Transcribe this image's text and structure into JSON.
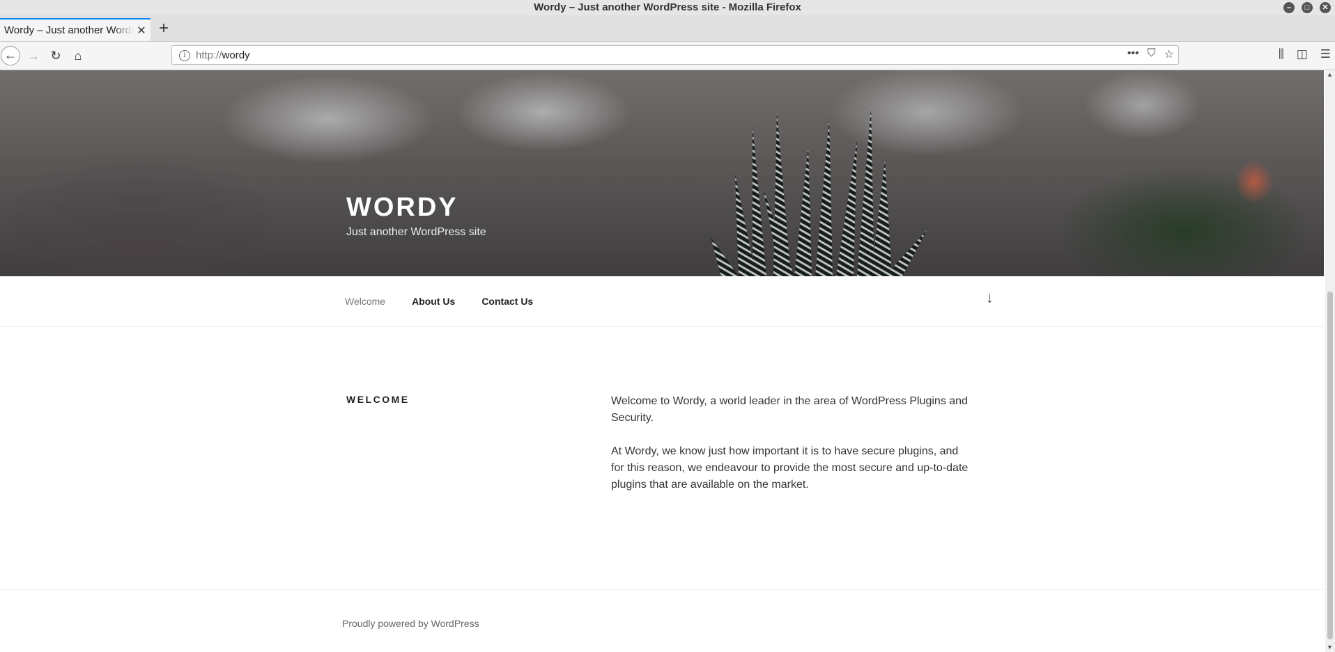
{
  "window": {
    "title": "Wordy – Just another WordPress site - Mozilla Firefox"
  },
  "tabs": [
    {
      "title": "Wordy – Just another WordPress site",
      "active": true
    }
  ],
  "navbar": {
    "url_protocol": "http://",
    "url_host": "wordy"
  },
  "site": {
    "title": "WORDY",
    "description": "Just another WordPress site",
    "menu": [
      "Welcome",
      "About Us",
      "Contact Us"
    ],
    "current_menu": "Welcome"
  },
  "page": {
    "title": "WELCOME",
    "paragraphs": [
      "Welcome to Wordy, a world leader in the area of WordPress Plugins and Security.",
      "At Wordy, we know just how important it is to have secure plugins, and for this reason, we endeavour to provide the most secure and up-to-date plugins that are available on the market."
    ]
  },
  "footer": {
    "powered": "Proudly powered by WordPress"
  },
  "colors": {
    "tab_accent": "#0a84ff",
    "menu_current": "#767676"
  }
}
